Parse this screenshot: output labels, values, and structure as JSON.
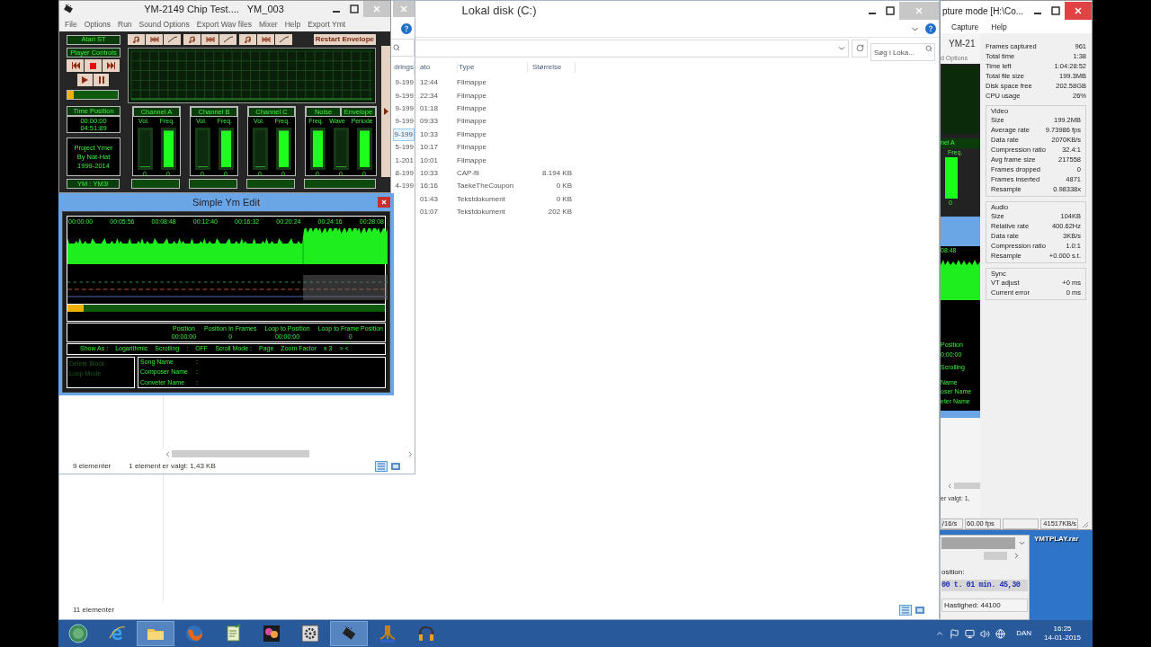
{
  "desktop": {
    "icon_label": "YMTPLAY.rar"
  },
  "explorer_main": {
    "title": "Lokal disk (C:)",
    "search": {
      "placeholder": "Søg i Loka..."
    },
    "columns": [
      "ato",
      "Type",
      "Størrelse"
    ],
    "rows": [
      {
        "time": "12:44",
        "type": "Filmappe"
      },
      {
        "time": "22:34",
        "type": "Filmappe"
      },
      {
        "time": "01:18",
        "type": "Filmappe"
      },
      {
        "time": "09:33",
        "type": "Filmappe"
      },
      {
        "time": "10:33",
        "type": "Filmappe"
      },
      {
        "time": "10:17",
        "type": "Filmappe"
      },
      {
        "time": "10:01",
        "type": "Filmappe"
      },
      {
        "time": "10:33",
        "type": "CAP-fil",
        "size": "8.194 KB"
      },
      {
        "time": "16:16",
        "type": "TaekeTheCoupon",
        "size": "0 KB"
      },
      {
        "time": "01:43",
        "type": "Tekstdokument",
        "size": "0 KB"
      },
      {
        "time": "01:07",
        "type": "Tekstdokument",
        "size": "202 KB"
      }
    ],
    "status": "11 elementer"
  },
  "explorer_small": {
    "column": "drings",
    "dates": [
      {
        "text": "9-199",
        "selected": false
      },
      {
        "text": "9-199",
        "selected": false
      },
      {
        "text": "9-199",
        "selected": false
      },
      {
        "text": "9-199",
        "selected": false
      },
      {
        "text": "9-199",
        "selected": true
      },
      {
        "text": "5-199",
        "selected": false
      },
      {
        "text": "1-201",
        "selected": false
      },
      {
        "text": "8-199",
        "selected": false
      },
      {
        "text": "4-199",
        "selected": false
      }
    ],
    "status_count": "9 elementer",
    "status_selection": "1 element er valgt: 1,43 KB"
  },
  "ym_player": {
    "title": "YM-2149 Chip Test....   YM_003",
    "menu": [
      "File",
      "Options",
      "Run",
      "Sound Options",
      "Export Wav files",
      "Mixer",
      "Help",
      "Export Ymt"
    ],
    "machine": "Atari ST",
    "restart_button": "Restart Envelope",
    "controls_label": "Player Controls",
    "progress": {
      "level": 0.12
    },
    "time_label": "Time Position",
    "time_current": "00:00:00",
    "time_total": "04:51:89",
    "credits": [
      "Project Ymer",
      "By Nat-Hat",
      "1999-2014"
    ],
    "format": "YM : YM3!",
    "channels": [
      {
        "headers": [
          "Channel A"
        ],
        "meters": [
          {
            "label": "Vol.",
            "level": 0,
            "value": "0"
          },
          {
            "label": "Freq.",
            "level": 1,
            "value": "0"
          }
        ]
      },
      {
        "headers": [
          "Channel B"
        ],
        "meters": [
          {
            "label": "Vol.",
            "level": 0,
            "value": "0"
          },
          {
            "label": "Freq.",
            "level": 1,
            "value": "0"
          }
        ]
      },
      {
        "headers": [
          "Channel C"
        ],
        "meters": [
          {
            "label": "Vol.",
            "level": 0,
            "value": "0"
          },
          {
            "label": "Freq.",
            "level": 1,
            "value": "0"
          }
        ]
      },
      {
        "headers": [
          "Noise",
          "Envelope"
        ],
        "meters": [
          {
            "label": "Freq.",
            "level": 1,
            "value": "0"
          },
          {
            "label": "Wave",
            "level": 0,
            "value": "0"
          },
          {
            "label": "Periode",
            "level": 1,
            "value": "0"
          }
        ]
      }
    ]
  },
  "ym_edit": {
    "title": "Simple Ym Edit",
    "ticks": [
      "00:00:00",
      "00:05:56",
      "00:08:48",
      "00:12:40",
      "00:16:32",
      "00:20:24",
      "00:24:16",
      "00:28:08"
    ],
    "progress": {
      "level": 0.05
    },
    "info": [
      {
        "label": "Position",
        "value": "00:00:00"
      },
      {
        "label": "Position In Frames",
        "value": "0"
      },
      {
        "label": "Loop to Position",
        "value": "00:00:00"
      },
      {
        "label": "Loop to Frame Position",
        "value": "0"
      }
    ],
    "options": [
      "Show As :",
      "Logarithmic",
      "Scrolling",
      ":",
      "OFF",
      "Scroll Mode :",
      "Page",
      "Zoom Factor",
      "x 3",
      "> <"
    ],
    "actions": [
      {
        "label": "Delete Block",
        "disabled": true
      },
      {
        "label": "Loop Mode",
        "disabled": true
      }
    ],
    "song_fields": [
      {
        "label": "Song Name",
        "separator": ":"
      },
      {
        "label": "Composer Name",
        "separator": ":"
      },
      {
        "label": "Conveter Name",
        "separator": ":"
      }
    ]
  },
  "capture": {
    "title": "pture mode [H:\\Co...",
    "menu": [
      "Capture",
      "Help"
    ],
    "preview": {
      "window_title": "YM-21",
      "menu": "d Options",
      "channel": "nel A",
      "meter_label": "Freq.",
      "meter_value": "0",
      "tick": "08:48",
      "info_label": "Position",
      "info_value": "0:00:00",
      "option": "Scrolling",
      "fields": [
        "Name",
        "oser Name",
        "eter Name"
      ],
      "status": "er valgt: 1,"
    },
    "stats": [
      {
        "label": "Frames captured",
        "value": "961"
      },
      {
        "label": "Total time",
        "value": "1:38"
      },
      {
        "label": "Time left",
        "value": "1:04:28:52"
      },
      {
        "label": "Total file size",
        "value": "199.3MB"
      },
      {
        "label": "Disk space free",
        "value": "202.58GB"
      },
      {
        "label": "CPU usage",
        "value": "26%"
      }
    ],
    "groups": [
      {
        "title": "Video",
        "rows": [
          {
            "label": "Size",
            "value": "199.2MB"
          },
          {
            "label": "Average rate",
            "value": "9.73986 fps"
          },
          {
            "label": "Data rate",
            "value": "2070KB/s"
          },
          {
            "label": "Compression ratio",
            "value": "32.4:1"
          },
          {
            "label": "Avg frame size",
            "value": "217558"
          },
          {
            "label": "Frames dropped",
            "value": "0"
          },
          {
            "label": "Frames inserted",
            "value": "4871"
          },
          {
            "label": "Resample",
            "value": "0.98338x"
          }
        ]
      },
      {
        "title": "Audio",
        "rows": [
          {
            "label": "Size",
            "value": "104KB"
          },
          {
            "label": "Relative rate",
            "value": "400.62Hz"
          },
          {
            "label": "Data rate",
            "value": "3KB/s"
          },
          {
            "label": "Compression ratio",
            "value": "1.0:1"
          },
          {
            "label": "Resample",
            "value": "+0.000 s.t."
          }
        ]
      },
      {
        "title": "Sync",
        "rows": [
          {
            "label": "VT adjust",
            "value": "+0 ms"
          },
          {
            "label": "Current error",
            "value": "0 ms"
          }
        ]
      }
    ],
    "status": {
      "rate": "/16/s",
      "fps": "60.00 fps",
      "throughput": "41517KB/s"
    }
  },
  "mini_player": {
    "position_label": "osition:",
    "position": "00 t. 01 min. 45,30",
    "speed": "Hastighed: 44100"
  },
  "taskbar": {
    "items": [
      {
        "kind": "start",
        "running": false
      },
      {
        "kind": "ie",
        "running": false
      },
      {
        "kind": "folder",
        "running": true
      },
      {
        "kind": "firefox",
        "running": false
      },
      {
        "kind": "notepad",
        "running": false
      },
      {
        "kind": "app",
        "running": false
      },
      {
        "kind": "gear",
        "running": false
      },
      {
        "kind": "chip",
        "running": true
      },
      {
        "kind": "steem",
        "running": false
      },
      {
        "kind": "headphones",
        "running": false
      }
    ],
    "language": "DAN",
    "time": "16:25",
    "date": "14-01-2015"
  }
}
